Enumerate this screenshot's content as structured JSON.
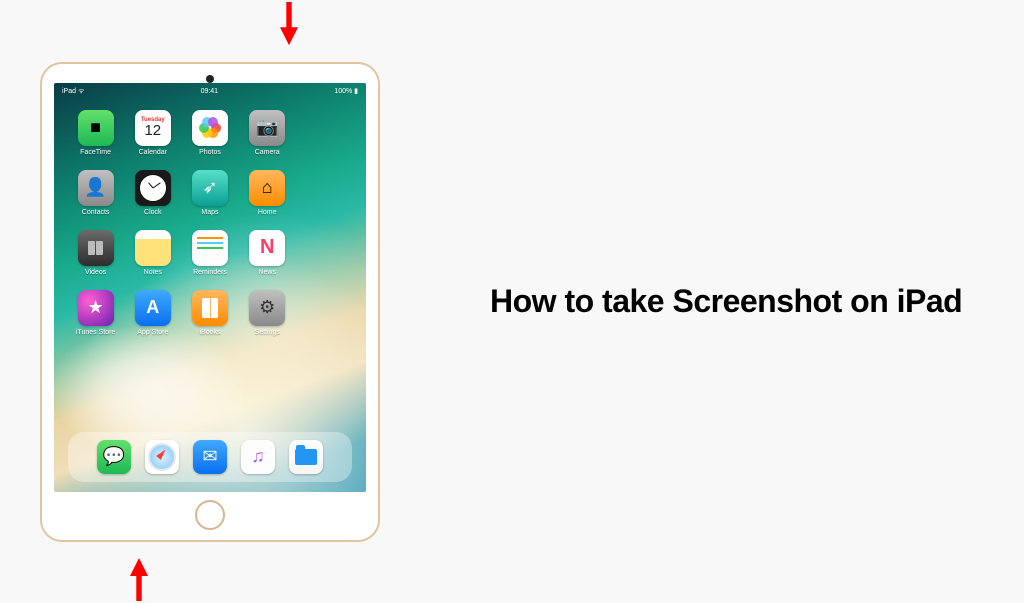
{
  "headline": "How to take Screenshot on iPad",
  "status_bar": {
    "left": "iPad ᯤ",
    "center": "09:41",
    "right": "100% ▮"
  },
  "calendar": {
    "day": "Tuesday",
    "date": "12"
  },
  "apps": [
    {
      "key": "facetime",
      "label": "FaceTime",
      "glyph": "■",
      "cls": "bg-green"
    },
    {
      "key": "calendar",
      "label": "Calendar",
      "glyph": "",
      "cls": "bg-white"
    },
    {
      "key": "photos",
      "label": "Photos",
      "glyph": "",
      "cls": "bg-white"
    },
    {
      "key": "camera",
      "label": "Camera",
      "glyph": "📷",
      "cls": "bg-grey"
    },
    {
      "key": "contacts",
      "label": "Contacts",
      "glyph": "👤",
      "cls": "bg-grey"
    },
    {
      "key": "clock",
      "label": "Clock",
      "glyph": "",
      "cls": "bg-black"
    },
    {
      "key": "maps",
      "label": "Maps",
      "glyph": "➶",
      "cls": "bg-teal"
    },
    {
      "key": "home",
      "label": "Home",
      "glyph": "⌂",
      "cls": "bg-orange"
    },
    {
      "key": "videos",
      "label": "Videos",
      "glyph": "",
      "cls": "bg-darkgrey"
    },
    {
      "key": "notes",
      "label": "Notes",
      "glyph": "",
      "cls": "bg-yellow"
    },
    {
      "key": "reminders",
      "label": "Reminders",
      "glyph": "",
      "cls": "bg-white"
    },
    {
      "key": "news",
      "label": "News",
      "glyph": "N",
      "cls": "bg-red"
    },
    {
      "key": "itunes",
      "label": "iTunes Store",
      "glyph": "★",
      "cls": "bg-purple"
    },
    {
      "key": "appstore",
      "label": "App Store",
      "glyph": "A",
      "cls": "bg-blue"
    },
    {
      "key": "ibooks",
      "label": "iBooks",
      "glyph": "▮",
      "cls": "bg-orange"
    },
    {
      "key": "settings",
      "label": "Settings",
      "glyph": "⚙",
      "cls": "bg-grey"
    }
  ],
  "dock": [
    {
      "key": "messages",
      "glyph": "💬",
      "cls": "bg-green"
    },
    {
      "key": "safari",
      "glyph": "",
      "cls": "bg-safari"
    },
    {
      "key": "mail",
      "glyph": "✉",
      "cls": "bg-blue"
    },
    {
      "key": "music",
      "glyph": "♫",
      "cls": "bg-white"
    },
    {
      "key": "files",
      "glyph": "",
      "cls": "bg-files"
    }
  ],
  "arrow_color": "#ff0000"
}
